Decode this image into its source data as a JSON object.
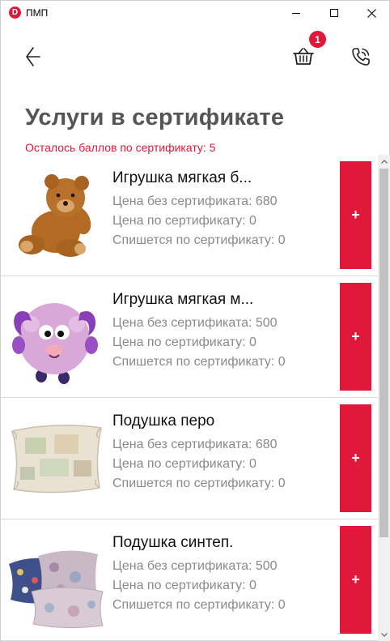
{
  "window": {
    "app_icon_letter": "D",
    "title": "ПМП",
    "controls": [
      "minimize-icon",
      "maximize-icon",
      "close-icon"
    ]
  },
  "header": {
    "back_icon": "arrow-left-icon",
    "cart_icon": "basket-icon",
    "cart_count": "1",
    "phone_icon": "phone-call-icon"
  },
  "page": {
    "title": "Услуги в сертификате",
    "points_left": "Осталось баллов по сертификату: 5"
  },
  "colors": {
    "accent": "#e0193a",
    "title_gray": "#555555",
    "secondary_text": "#8a8a8a"
  },
  "items": [
    {
      "image": "teddy-bear-image",
      "name": "Игрушка мягкая б...",
      "price_no_cert": "Цена без сертификата: 680",
      "price_cert": "Цена по сертификату: 0",
      "deducted": "Спишется по сертификату: 0",
      "add_label": "+"
    },
    {
      "image": "plush-sheep-image",
      "name": "Игрушка мягкая м...",
      "price_no_cert": "Цена без сертификата: 500",
      "price_cert": "Цена по сертификату: 0",
      "deducted": "Спишется по сертификату: 0",
      "add_label": "+"
    },
    {
      "image": "feather-pillow-image",
      "name": "Подушка перо",
      "price_no_cert": "Цена без сертификата: 680",
      "price_cert": "Цена по сертификату: 0",
      "deducted": "Спишется по сертификату: 0",
      "add_label": "+"
    },
    {
      "image": "synthetic-pillows-image",
      "name": "Подушка синтеп.",
      "price_no_cert": "Цена без сертификата: 500",
      "price_cert": "Цена по сертификату: 0",
      "deducted": "Спишется по сертификату: 0",
      "add_label": "+"
    }
  ]
}
